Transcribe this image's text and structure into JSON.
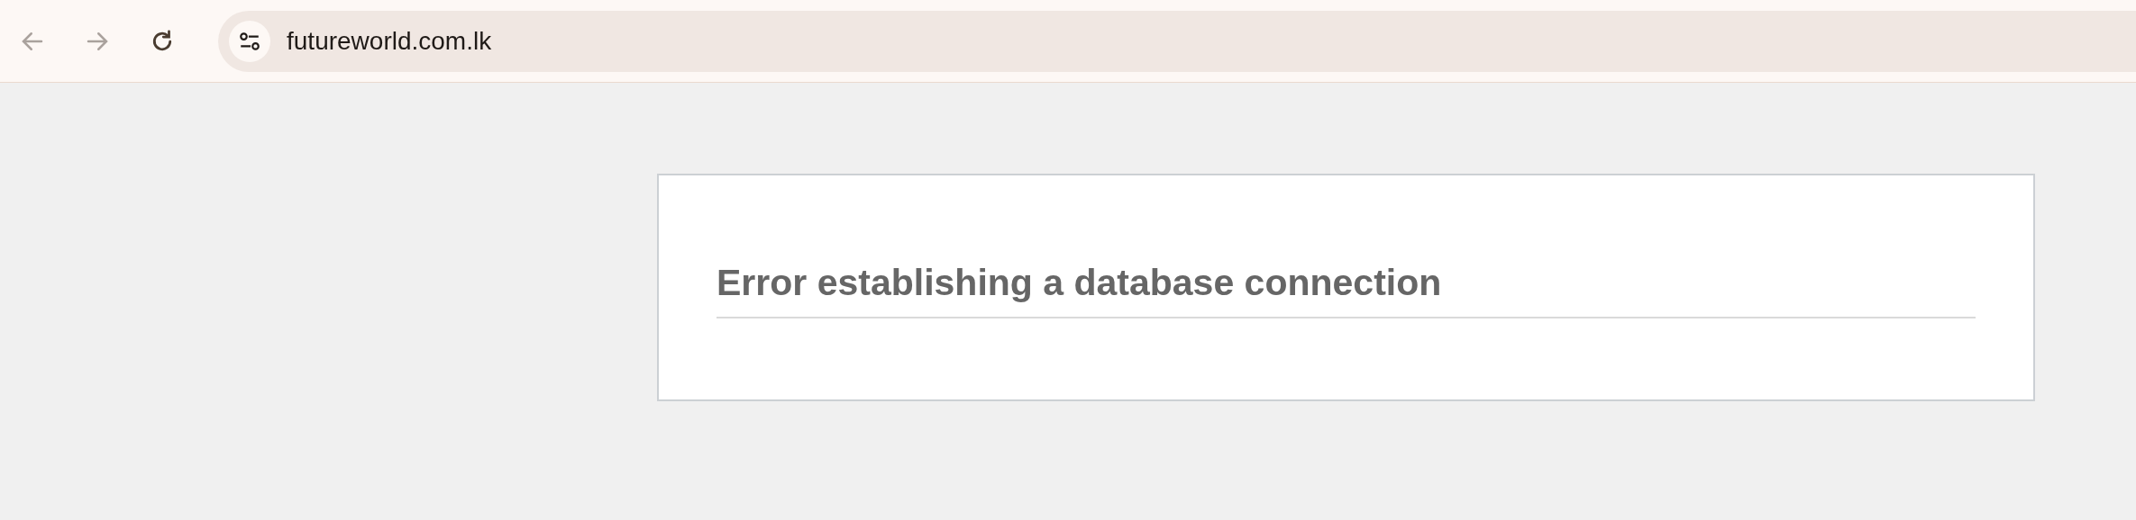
{
  "address_bar": {
    "url": "futureworld.com.lk"
  },
  "page": {
    "heading": "Error establishing a database connection"
  }
}
